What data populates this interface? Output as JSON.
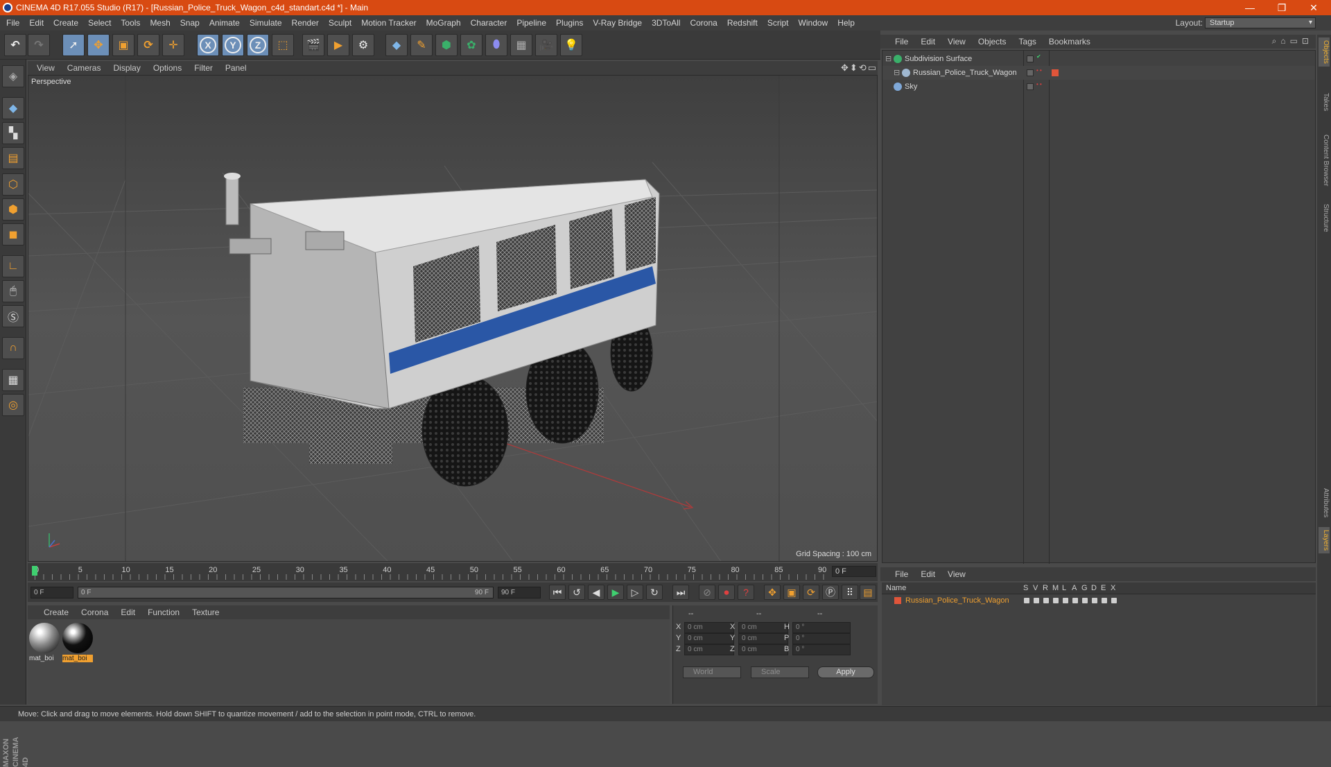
{
  "title_bar": {
    "text": "CINEMA 4D R17.055 Studio (R17) - [Russian_Police_Truck_Wagon_c4d_standart.c4d *] - Main",
    "minimize": "—",
    "restore": "❐",
    "close": "✕"
  },
  "menubar": {
    "items": [
      "File",
      "Edit",
      "Create",
      "Select",
      "Tools",
      "Mesh",
      "Snap",
      "Animate",
      "Simulate",
      "Render",
      "Sculpt",
      "Motion Tracker",
      "MoGraph",
      "Character",
      "Pipeline",
      "Plugins",
      "V-Ray Bridge",
      "3DToAll",
      "Corona",
      "Redshift",
      "Script",
      "Window",
      "Help"
    ],
    "layout_label": "Layout:",
    "layout_value": "Startup"
  },
  "toolbar": {
    "axis_x": "X",
    "axis_y": "Y",
    "axis_z": "Z"
  },
  "viewport": {
    "menu": [
      "View",
      "Cameras",
      "Display",
      "Options",
      "Filter",
      "Panel"
    ],
    "label": "Perspective",
    "grid_spacing": "Grid Spacing : 100 cm",
    "nav_icons": "✥⬍⟲▭"
  },
  "timeline": {
    "ticks": [
      "0",
      "5",
      "10",
      "15",
      "20",
      "25",
      "30",
      "35",
      "40",
      "45",
      "50",
      "55",
      "60",
      "65",
      "70",
      "75",
      "80",
      "85",
      "90"
    ],
    "current_frame": "0 F",
    "start_field": "0 F",
    "range_start": "0 F",
    "range_end": "90 F",
    "end_field": "90 F"
  },
  "material_manager": {
    "menu": [
      "Create",
      "Corona",
      "Edit",
      "Function",
      "Texture"
    ],
    "materials": [
      {
        "label": "mat_boi",
        "color": "#8a8a8a",
        "selected": false
      },
      {
        "label": "mat_boi",
        "color": "#111111",
        "selected": true
      }
    ]
  },
  "coordinates": {
    "headers": [
      "--",
      "--",
      "--"
    ],
    "rows": [
      {
        "a": "X",
        "av": "0 cm",
        "b": "X",
        "bv": "0 cm",
        "c": "H",
        "cv": "0 °"
      },
      {
        "a": "Y",
        "av": "0 cm",
        "b": "Y",
        "bv": "0 cm",
        "c": "P",
        "cv": "0 °"
      },
      {
        "a": "Z",
        "av": "0 cm",
        "b": "Z",
        "bv": "0 cm",
        "c": "B",
        "cv": "0 °"
      }
    ],
    "mode1": "World",
    "mode2": "Scale",
    "apply": "Apply"
  },
  "object_manager": {
    "menu": [
      "File",
      "Edit",
      "View",
      "Objects",
      "Tags",
      "Bookmarks"
    ],
    "objects": [
      {
        "name": "Subdivision Surface",
        "icon_color": "#3ab06a"
      },
      {
        "name": "Russian_Police_Truck_Wagon",
        "icon_color": "#9fb7d0",
        "tag_color": "#e0553a"
      },
      {
        "name": "Sky",
        "icon_color": "#7fa8d8"
      }
    ]
  },
  "right_tabs": [
    "Objects",
    "Takes",
    "Content Browser",
    "Structure",
    "Attributes",
    "Layers"
  ],
  "layer_manager": {
    "menu": [
      "File",
      "Edit",
      "View"
    ],
    "headers": [
      "Name",
      "S",
      "V",
      "R",
      "M",
      "L",
      "A",
      "G",
      "D",
      "E",
      "X"
    ],
    "layers": [
      {
        "name": "Russian_Police_Truck_Wagon",
        "color": "#e0553a"
      }
    ]
  },
  "status_bar": {
    "text": "Move: Click and drag to move elements. Hold down SHIFT to quantize movement / add to the selection in point mode, CTRL to remove."
  },
  "branding": {
    "text": "MAXON CINEMA 4D"
  },
  "colors": {
    "accent": "#d84a12",
    "selection": "#6c8fb8",
    "layer_orange": "#f0a030"
  }
}
